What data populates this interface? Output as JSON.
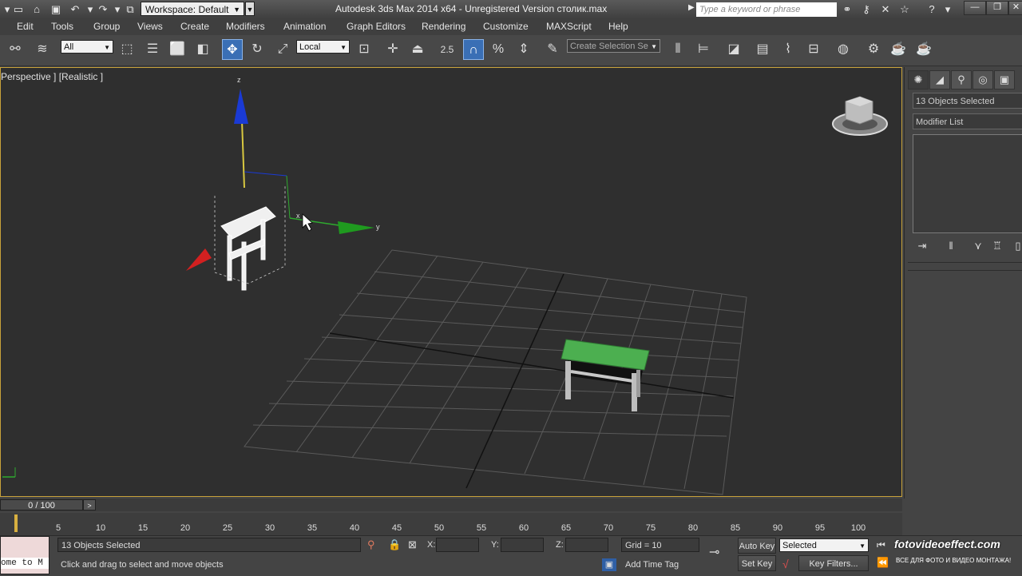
{
  "title_bar": {
    "app_title": "Autodesk 3ds Max  2014 x64  - Unregistered Version   столик.max",
    "workspace_label": "Workspace: Default",
    "search_placeholder": "Type a keyword or phrase"
  },
  "menu": {
    "items": [
      "Edit",
      "Tools",
      "Group",
      "Views",
      "Create",
      "Modifiers",
      "Animation",
      "Graph Editors",
      "Rendering",
      "Customize",
      "MAXScript",
      "Help"
    ]
  },
  "toolbar": {
    "selection_filter": "All",
    "ref_coord": "Local",
    "snap_angle": "2.5",
    "named_selection_placeholder": "Create Selection Se"
  },
  "viewport": {
    "label": "Perspective ] [Realistic ]",
    "axis_x": "x",
    "axis_y": "y",
    "axis_z": "z"
  },
  "command_panel": {
    "selection_field": "13 Objects Selected",
    "modifier_list": "Modifier List"
  },
  "timeline": {
    "frame_display": "0 / 100",
    "ticks": [
      "5",
      "10",
      "15",
      "20",
      "25",
      "30",
      "35",
      "40",
      "45",
      "50",
      "55",
      "60",
      "65",
      "70",
      "75",
      "80",
      "85",
      "90",
      "95",
      "100"
    ]
  },
  "status": {
    "maxscript_text": "ome to M",
    "selection": "13 Objects Selected",
    "prompt": "Click and drag to select and move objects",
    "x_label": "X:",
    "y_label": "Y:",
    "z_label": "Z:",
    "grid": "Grid = 10",
    "add_time_tag": "Add Time Tag",
    "auto_key": "Auto Key",
    "set_key": "Set Key",
    "key_mode": "Selected",
    "key_filters": "Key Filters..."
  },
  "watermark": {
    "main": "fotovideoeffect.com",
    "sub": "ВСЕ ДЛЯ ФОТО И ВИДЕО МОНТАЖА!"
  },
  "colors": {
    "accent_active": "#3a6fb5",
    "viewport_border": "#c8a23a",
    "table_top": "#4caf50",
    "gizmo_x": "#d32020",
    "gizmo_y": "#2faa2f",
    "gizmo_z": "#1a3ad4"
  }
}
